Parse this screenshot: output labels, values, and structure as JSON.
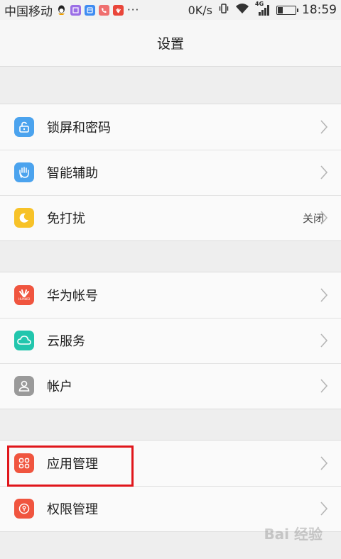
{
  "status_bar": {
    "carrier": "中国移动",
    "more": "···",
    "net_speed": "0K/s",
    "network_type": "4G",
    "battery_level": 0.3,
    "time": "18:59",
    "notification_icons": [
      "qq-icon",
      "gallery-icon",
      "calendar-icon",
      "phone-icon",
      "huawei-icon"
    ]
  },
  "header": {
    "title": "设置"
  },
  "groups": [
    {
      "items": [
        {
          "label": "锁屏和密码",
          "icon": "lock-icon",
          "icon_color": "#4ba3ee"
        },
        {
          "label": "智能辅助",
          "icon": "hand-icon",
          "icon_color": "#4ba3ee"
        },
        {
          "label": "免打扰",
          "icon": "moon-icon",
          "icon_color": "#f7c228",
          "value": "关闭"
        }
      ]
    },
    {
      "items": [
        {
          "label": "华为帐号",
          "icon": "huawei-icon",
          "icon_color": "#f0553f",
          "icon_text": "HUAWEI"
        },
        {
          "label": "云服务",
          "icon": "cloud-icon",
          "icon_color": "#22c6ad"
        },
        {
          "label": "帐户",
          "icon": "user-icon",
          "icon_color": "#9a9a9a"
        }
      ]
    },
    {
      "items": [
        {
          "label": "应用管理",
          "icon": "apps-icon",
          "icon_color": "#f0553f"
        },
        {
          "label": "权限管理",
          "icon": "permission-icon",
          "icon_color": "#f0553f"
        }
      ]
    }
  ],
  "watermark": "Bai 经验"
}
